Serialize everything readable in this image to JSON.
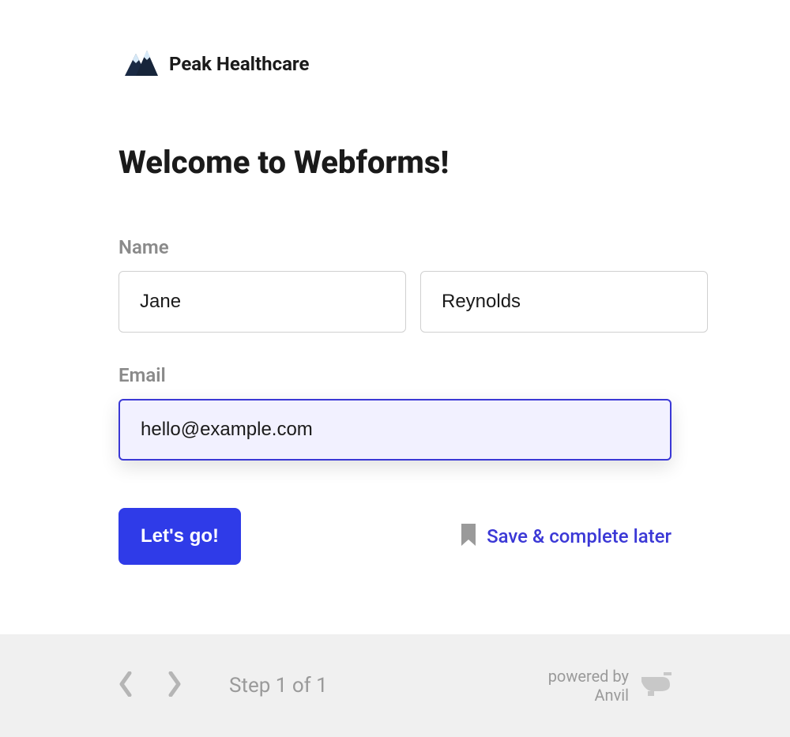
{
  "header": {
    "brand_name": "Peak Healthcare"
  },
  "page": {
    "title": "Welcome to Webforms!"
  },
  "form": {
    "name_label": "Name",
    "first_name_value": "Jane",
    "last_name_value": "Reynolds",
    "email_label": "Email",
    "email_value": "hello@example.com"
  },
  "actions": {
    "submit_label": "Let's go!",
    "save_later_label": "Save & complete later"
  },
  "footer": {
    "step_label": "Step 1 of 1",
    "powered_by_line1": "powered by",
    "powered_by_line2": "Anvil"
  }
}
